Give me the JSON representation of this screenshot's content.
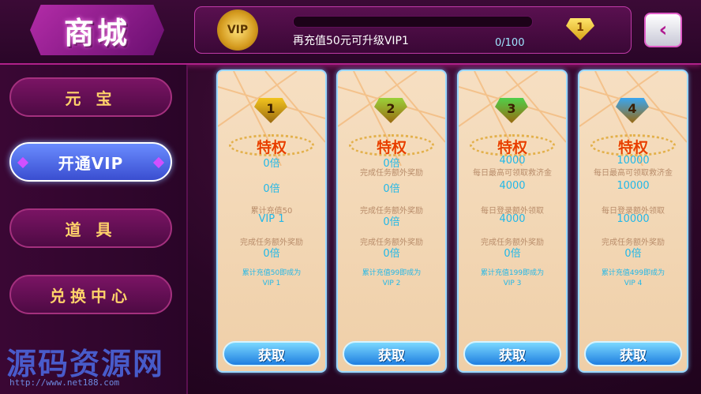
{
  "header": {
    "title": "商城",
    "vip_badge": "VIP",
    "upgrade_message": "再充值50元可升级VIP1",
    "progress_text": "0/100",
    "progress_fraction": 0.0,
    "next_level": "1",
    "back_icon": "chevron-left-icon"
  },
  "sidebar": {
    "items": [
      {
        "label": "元 宝"
      },
      {
        "label": "开通VIP"
      },
      {
        "label": "道 具"
      },
      {
        "label": "兑换中心"
      }
    ]
  },
  "cards": [
    {
      "level": "1",
      "gem_color": "#f2c41e",
      "privilege": "特权",
      "line1": "",
      "value1": "0倍",
      "line2": "累计充值50",
      "value2": "VIP 1",
      "line3": "完成任务额外奖励",
      "value3": "0倍",
      "footer1": "累计充值50即成为",
      "footer2": "VIP 1",
      "button": "获取"
    },
    {
      "level": "2",
      "gem_color": "#9ad13a",
      "privilege": "特权",
      "line1": "完成任务额外奖励",
      "value1": "0倍",
      "line2": "完成任务额外奖励",
      "value2": "0倍",
      "line3": "完成任务额外奖励",
      "value3": "0倍",
      "footer1": "累计充值99即成为",
      "footer2": "VIP 2",
      "button": "获取"
    },
    {
      "level": "3",
      "gem_color": "#4fcf4a",
      "privilege": "特权",
      "line1": "每日最高可领取救济金",
      "value1": "4000",
      "line2": "每日登录额外领取",
      "value2": "4000",
      "line3": "完成任务额外奖励",
      "value3": "0倍",
      "footer1": "累计充值199即成为",
      "footer2": "VIP 3",
      "button": "获取"
    },
    {
      "level": "4",
      "gem_color": "#3aa6f0",
      "privilege": "特权",
      "line1": "每日最高可领取救济金",
      "value1": "10000",
      "line2": "每日登录额外领取",
      "value2": "10000",
      "line3": "完成任务额外奖励",
      "value3": "0倍",
      "footer1": "累计充值499即成为",
      "footer2": "VIP 4",
      "button": "获取"
    }
  ],
  "watermark": {
    "text": "源码资源网",
    "url": "http://www.net188.com"
  }
}
